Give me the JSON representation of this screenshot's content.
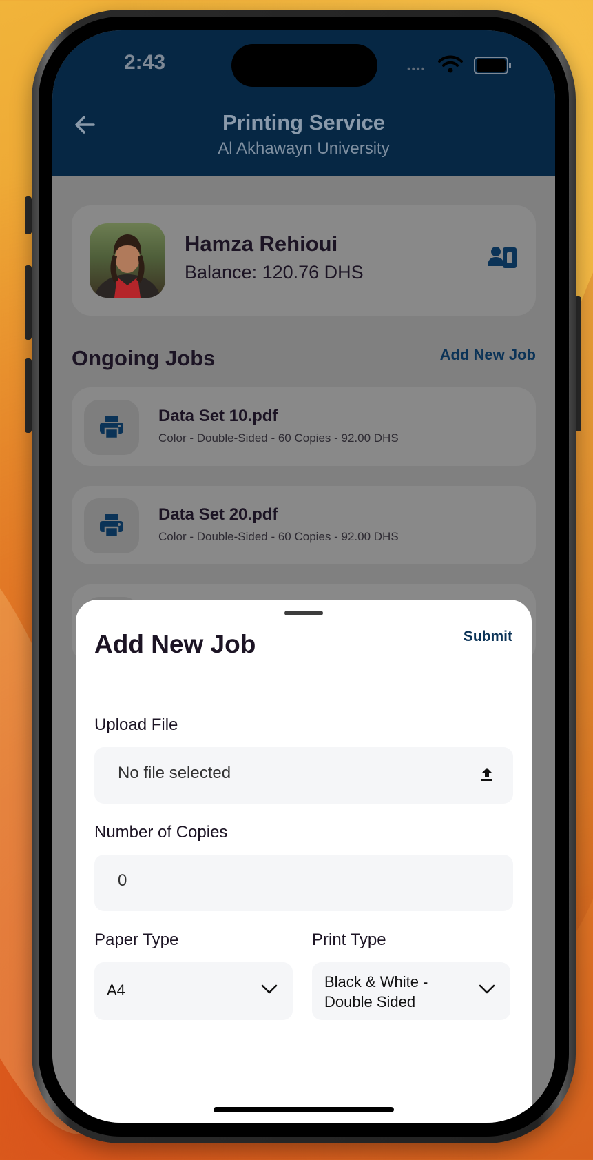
{
  "status_bar": {
    "time": "2:43"
  },
  "header": {
    "title": "Printing Service",
    "subtitle": "Al Akhawayn University"
  },
  "profile": {
    "name": "Hamza Rehioui",
    "balance": "Balance: 120.76 DHS"
  },
  "jobs_section": {
    "title": "Ongoing Jobs",
    "add_link": "Add New Job"
  },
  "jobs": [
    {
      "file": "Data Set 10.pdf",
      "details": "Color - Double-Sided - 60 Copies - 92.00 DHS"
    },
    {
      "file": "Data Set 20.pdf",
      "details": "Color - Double-Sided - 60 Copies - 92.00 DHS"
    }
  ],
  "sheet": {
    "title": "Add New Job",
    "submit_label": "Submit",
    "upload_label": "Upload File",
    "upload_value": "No file selected",
    "copies_label": "Number of Copies",
    "copies_value": "0",
    "paper_type_label": "Paper Type",
    "paper_type_value": "A4",
    "print_type_label": "Print Type",
    "print_type_line1": "Black & White -",
    "print_type_line2": "Double Sided"
  },
  "icons": {
    "back": "back-arrow-icon",
    "id_card": "id-card-icon",
    "printer": "printer-icon",
    "upload": "upload-icon",
    "dropdown": "chevron-down-icon"
  },
  "colors": {
    "header_bg": "#062744",
    "accent": "#0b3357",
    "sheet_bg": "#ffffff",
    "field_bg": "#f5f6f8"
  }
}
